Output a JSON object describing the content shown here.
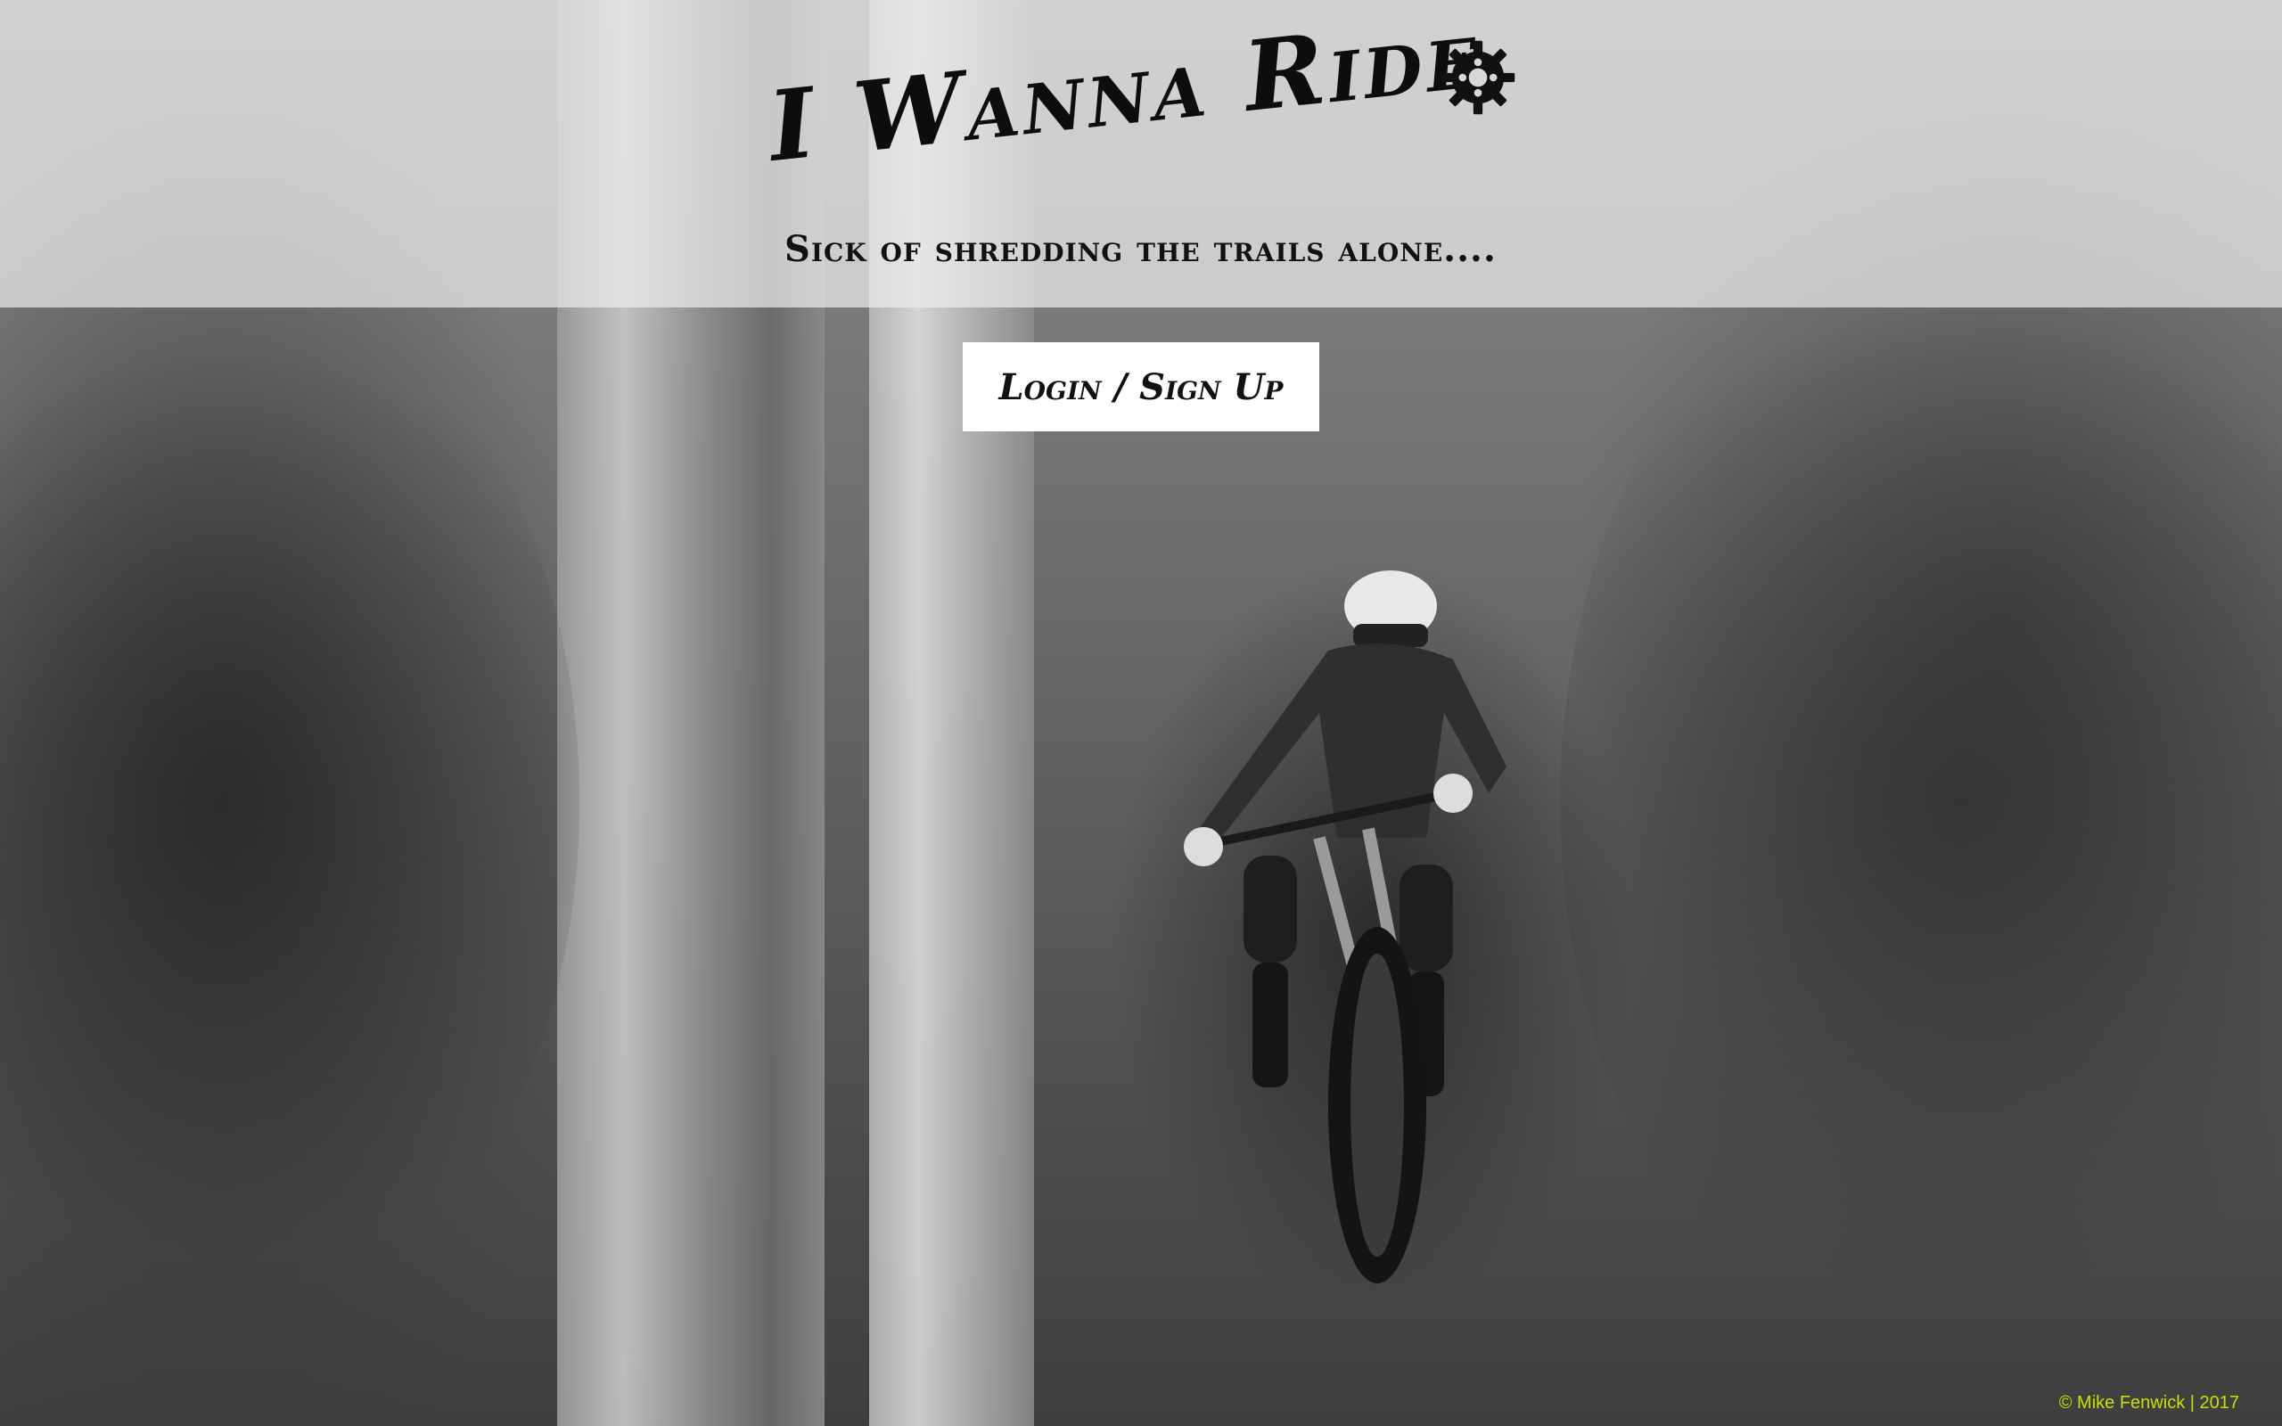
{
  "hero": {
    "title": "I Wanna Ride",
    "title_icon": "gear-icon",
    "tagline": "Sick of shredding the trails alone....",
    "background": "black-and-white photo of a mountain biker jumping on a forest trail"
  },
  "actions": {
    "login_label": "Login / Sign Up"
  },
  "footer": {
    "credit": "© Mike Fenwick | 2017",
    "credit_color": "#c8e000"
  }
}
